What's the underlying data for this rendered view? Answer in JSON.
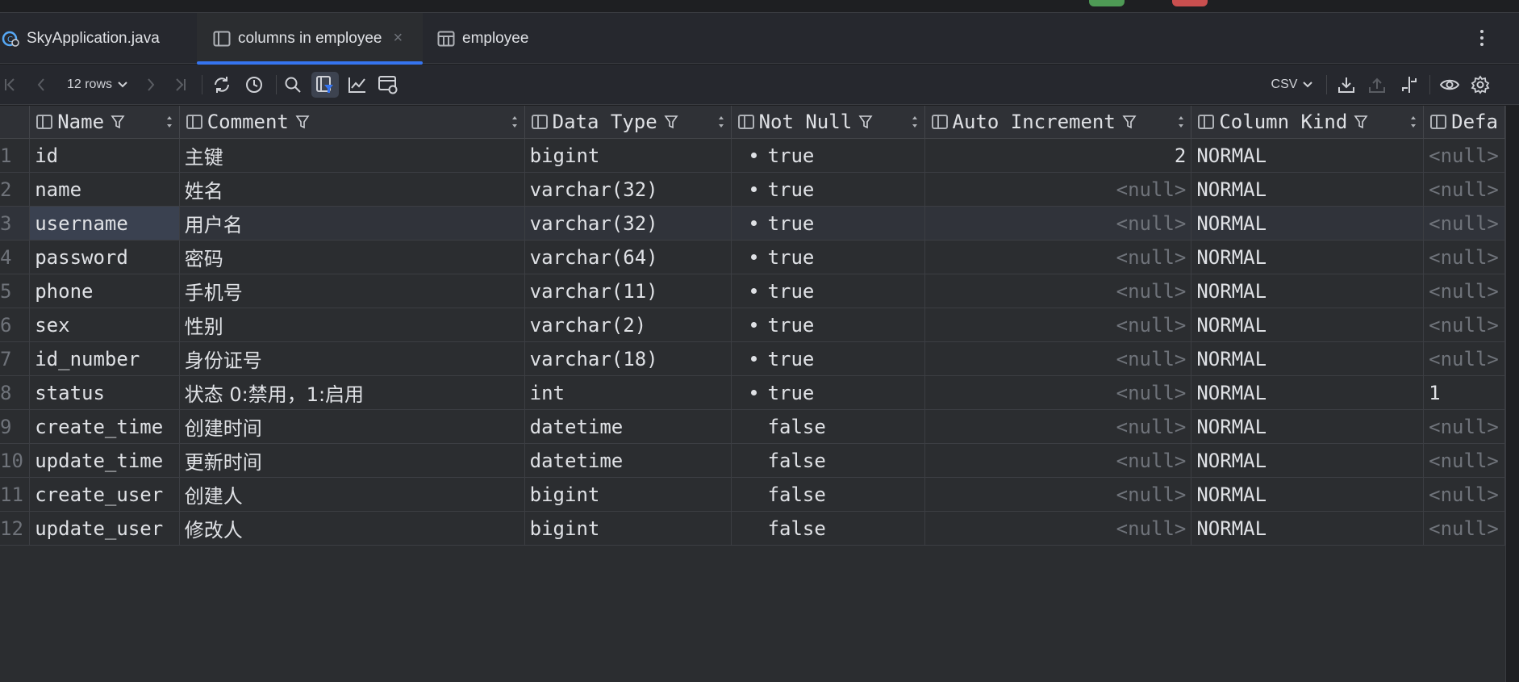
{
  "top_chips": {
    "green": "#4e9a55",
    "red": "#c94f4f"
  },
  "tabs": [
    {
      "label": "SkyApplication.java",
      "icon": "java-class-icon"
    },
    {
      "label": "columns in employee",
      "icon": "table-view-icon",
      "active": true
    },
    {
      "label": "employee",
      "icon": "table-grid-icon"
    }
  ],
  "toolbar": {
    "rows_label": "12 rows",
    "export_format": "CSV"
  },
  "columns": [
    "Name",
    "Comment",
    "Data Type",
    "Not Null",
    "Auto Increment",
    "Column Kind",
    "Defa"
  ],
  "rows": [
    {
      "n": "1",
      "name": "id",
      "comment": "主键",
      "type": "bigint",
      "notnull": "true",
      "autoinc": "2",
      "kind": "NORMAL",
      "def": "<null>"
    },
    {
      "n": "2",
      "name": "name",
      "comment": "姓名",
      "type": "varchar(32)",
      "notnull": "true",
      "autoinc": "<null>",
      "kind": "NORMAL",
      "def": "<null>"
    },
    {
      "n": "3",
      "name": "username",
      "comment": "用户名",
      "type": "varchar(32)",
      "notnull": "true",
      "autoinc": "<null>",
      "kind": "NORMAL",
      "def": "<null>"
    },
    {
      "n": "4",
      "name": "password",
      "comment": "密码",
      "type": "varchar(64)",
      "notnull": "true",
      "autoinc": "<null>",
      "kind": "NORMAL",
      "def": "<null>"
    },
    {
      "n": "5",
      "name": "phone",
      "comment": "手机号",
      "type": "varchar(11)",
      "notnull": "true",
      "autoinc": "<null>",
      "kind": "NORMAL",
      "def": "<null>"
    },
    {
      "n": "6",
      "name": "sex",
      "comment": "性别",
      "type": "varchar(2)",
      "notnull": "true",
      "autoinc": "<null>",
      "kind": "NORMAL",
      "def": "<null>"
    },
    {
      "n": "7",
      "name": "id_number",
      "comment": "身份证号",
      "type": "varchar(18)",
      "notnull": "true",
      "autoinc": "<null>",
      "kind": "NORMAL",
      "def": "<null>"
    },
    {
      "n": "8",
      "name": "status",
      "comment": "状态 0:禁用，1:启用",
      "type": "int",
      "notnull": "true",
      "autoinc": "<null>",
      "kind": "NORMAL",
      "def": "1"
    },
    {
      "n": "9",
      "name": "create_time",
      "comment": "创建时间",
      "type": "datetime",
      "notnull": "false",
      "autoinc": "<null>",
      "kind": "NORMAL",
      "def": "<null>"
    },
    {
      "n": "10",
      "name": "update_time",
      "comment": "更新时间",
      "type": "datetime",
      "notnull": "false",
      "autoinc": "<null>",
      "kind": "NORMAL",
      "def": "<null>"
    },
    {
      "n": "11",
      "name": "create_user",
      "comment": "创建人",
      "type": "bigint",
      "notnull": "false",
      "autoinc": "<null>",
      "kind": "NORMAL",
      "def": "<null>"
    },
    {
      "n": "12",
      "name": "update_user",
      "comment": "修改人",
      "type": "bigint",
      "notnull": "false",
      "autoinc": "<null>",
      "kind": "NORMAL",
      "def": "<null>"
    }
  ],
  "selected_row": "3"
}
